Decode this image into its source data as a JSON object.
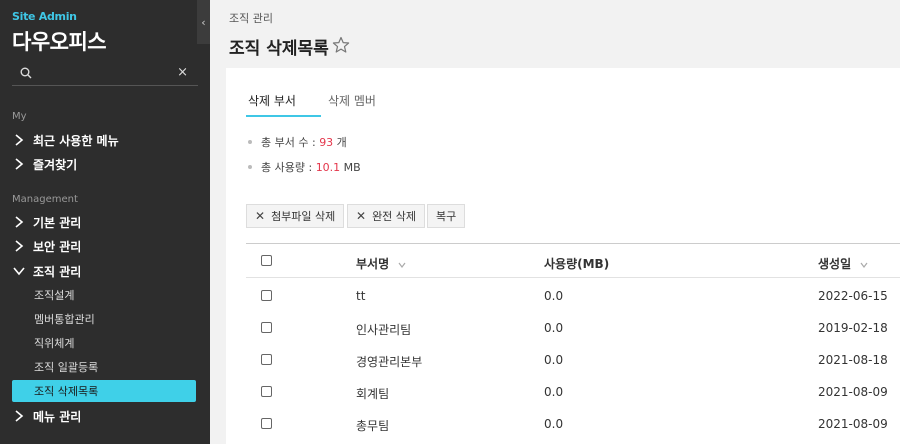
{
  "sidebar": {
    "brand_small": "Site Admin",
    "brand_big": "다우오피스",
    "collapse_glyph": "‹",
    "clear_glyph": "×",
    "sections": [
      {
        "label": "My",
        "items": [
          "최근 사용한 메뉴",
          "즐겨찾기"
        ]
      },
      {
        "label": "Management",
        "items": [
          "기본 관리",
          "보안 관리",
          "조직 관리",
          "메뉴 관리"
        ]
      }
    ],
    "org_subitems": [
      "조직설계",
      "멤버통합관리",
      "직위체계",
      "조직 일괄등록",
      "조직 삭제목록"
    ],
    "active_subitem": "조직 삭제목록"
  },
  "header": {
    "breadcrumb": "조직 관리",
    "title": "조직 삭제목록"
  },
  "tabs": [
    {
      "label": "삭제 부서",
      "active": true
    },
    {
      "label": "삭제 멤버",
      "active": false
    }
  ],
  "stats": {
    "dept_prefix": "총 부서 수 : ",
    "dept_count": "93",
    "dept_suffix": " 개",
    "usage_prefix": "총 사용량 : ",
    "usage_value": "10.1",
    "usage_suffix": " MB"
  },
  "actions": {
    "delete_attachments": "첨부파일 삭제",
    "delete_permanently": "완전 삭제",
    "restore": "복구",
    "x_glyph": "✕"
  },
  "table": {
    "columns": {
      "name": "부서명",
      "usage": "사용량(MB)",
      "created": "생성일"
    },
    "rows": [
      {
        "name": "tt",
        "usage": "0.0",
        "created": "2022-06-15"
      },
      {
        "name": "인사관리팀",
        "usage": "0.0",
        "created": "2019-02-18"
      },
      {
        "name": "경영관리본부",
        "usage": "0.0",
        "created": "2021-08-18"
      },
      {
        "name": "회계팀",
        "usage": "0.0",
        "created": "2021-08-09"
      },
      {
        "name": "총무팀",
        "usage": "0.0",
        "created": "2021-08-09"
      }
    ]
  },
  "colors": {
    "accent": "#3fc7e6",
    "sidebar_bg": "#2d2d2d",
    "highlight_number": "#e4364b"
  }
}
